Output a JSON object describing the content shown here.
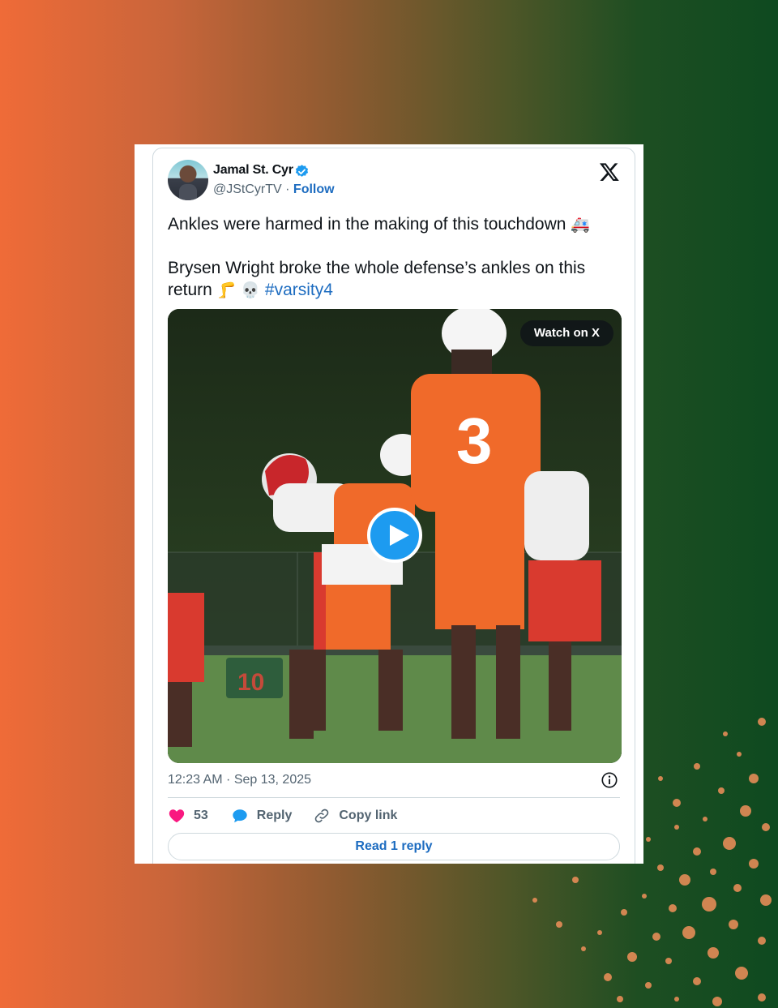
{
  "author": {
    "name": "Jamal St. Cyr",
    "handle": "@JStCyrTV",
    "separator": "·",
    "follow_label": "Follow"
  },
  "tweet": {
    "line1": "Ankles were harmed in the making of this touchdown",
    "line1_emoji": "🚑",
    "line2": "Brysen Wright broke the whole defense’s ankles on this return",
    "line2_emojis": "🦵 💀",
    "hashtag": "#varsity4"
  },
  "media": {
    "watch_label": "Watch on X",
    "jersey_number": "3"
  },
  "meta": {
    "timestamp": "12:23 AM · Sep 13, 2025"
  },
  "actions": {
    "likes_count": "53",
    "reply_label": "Reply",
    "copy_label": "Copy link"
  },
  "footer": {
    "read_reply_label": "Read 1 reply"
  },
  "icons": [
    "verified-icon",
    "x-logo-icon",
    "info-icon",
    "heart-icon",
    "reply-icon",
    "link-icon",
    "play-icon"
  ],
  "colors": {
    "accent": "#1d6cc0",
    "verified": "#1d9bf0",
    "heart": "#f91880",
    "background_left": "#ef6b38",
    "background_right": "#0e4a20"
  }
}
